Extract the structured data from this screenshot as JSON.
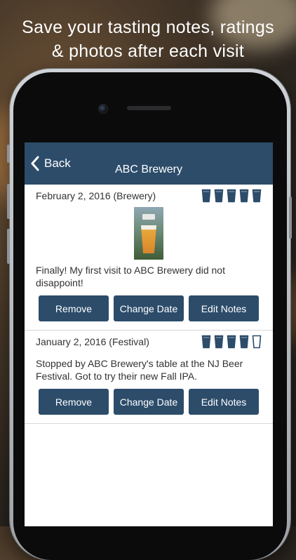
{
  "headline": {
    "line1": "Save your tasting notes, ratings",
    "line2": "& photos after each visit"
  },
  "navbar": {
    "back_label": "Back",
    "title": "ABC Brewery"
  },
  "colors": {
    "nav": "#2c4c6a",
    "button": "#2c4c6a",
    "mug_filled": "#2c4c6a"
  },
  "entries": [
    {
      "date_label": "February 2, 2016 (Brewery)",
      "rating": 5,
      "rating_max": 5,
      "has_photo": true,
      "notes": "Finally! My first visit to ABC Brewery did not disappoint!",
      "buttons": [
        "Remove",
        "Change Date",
        "Edit Notes"
      ]
    },
    {
      "date_label": "January 2, 2016 (Festival)",
      "rating": 4,
      "rating_max": 5,
      "has_photo": false,
      "notes": "Stopped by ABC Brewery's table at the NJ Beer Festival. Got to try their new Fall IPA.",
      "buttons": [
        "Remove",
        "Change Date",
        "Edit Notes"
      ]
    }
  ],
  "icons": {
    "back": "chevron-left-icon",
    "rating": "beer-mug-icon",
    "photo": "beer-glass-photo"
  }
}
